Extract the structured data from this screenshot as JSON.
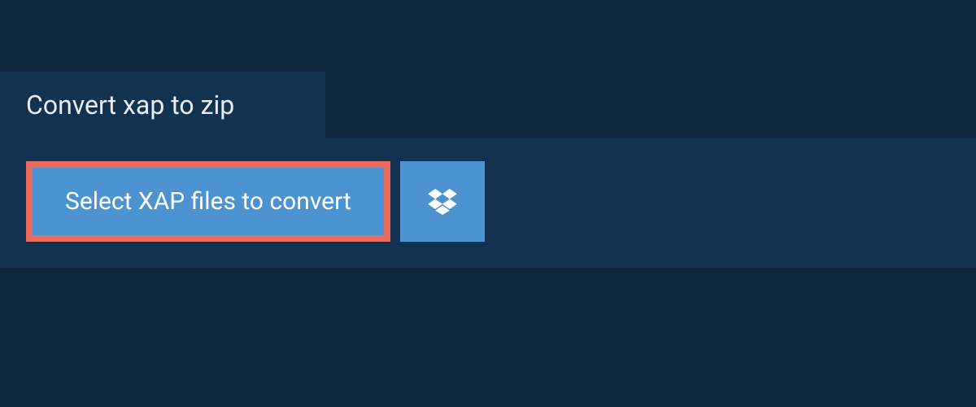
{
  "tab": {
    "label": "Convert xap to zip"
  },
  "actions": {
    "select_label": "Select XAP files to convert"
  },
  "colors": {
    "panel_bg": "#13324f",
    "button_bg": "#4d93d2",
    "button_border": "#e86a5f",
    "page_bg": "#0f2740"
  }
}
